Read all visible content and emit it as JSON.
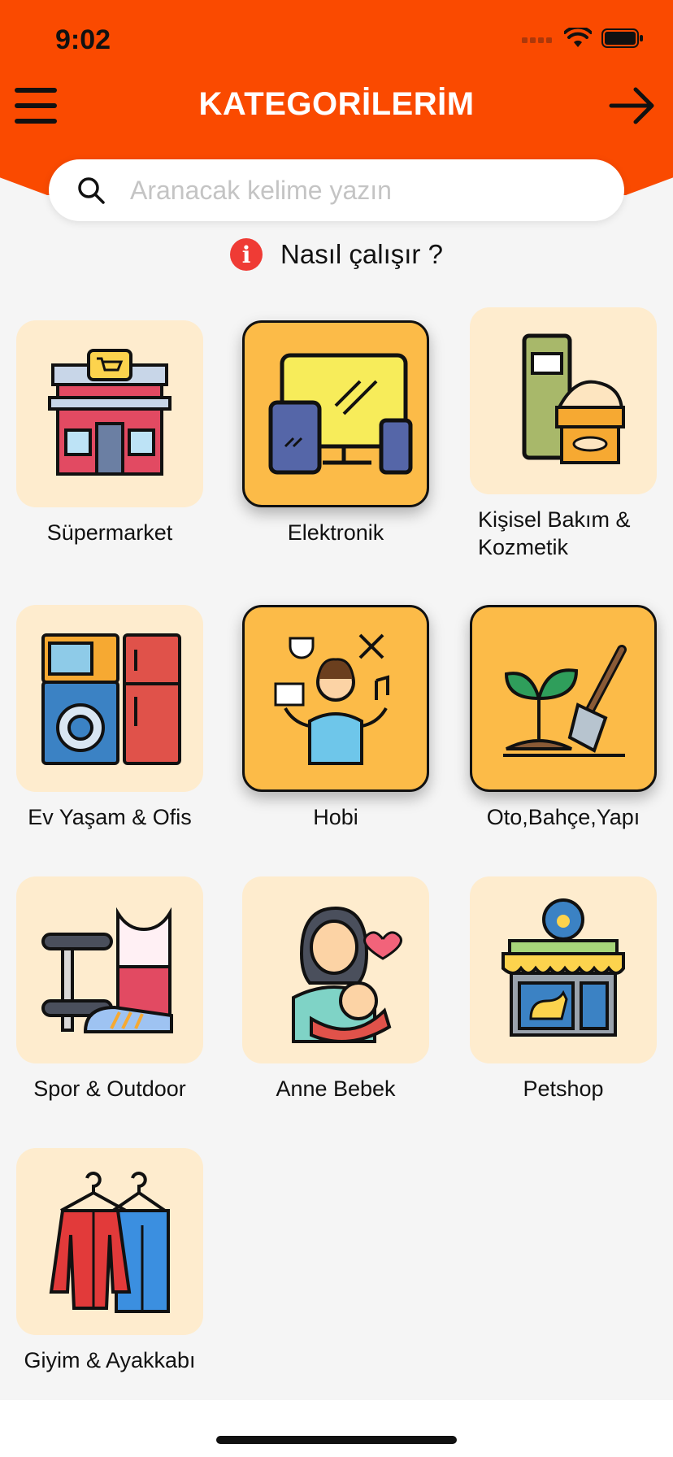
{
  "status": {
    "time": "9:02"
  },
  "header": {
    "title": "KATEGORİLERİM"
  },
  "search": {
    "placeholder": "Aranacak kelime yazın",
    "value": ""
  },
  "help": {
    "label": "Nasıl çalışır ?"
  },
  "categories": [
    {
      "label": "Süpermarket",
      "icon": "supermarket-icon",
      "selected": false
    },
    {
      "label": "Elektronik",
      "icon": "electronics-icon",
      "selected": true
    },
    {
      "label": "Kişisel Bakım & Kozmetik",
      "icon": "cosmetics-icon",
      "selected": false
    },
    {
      "label": "Ev Yaşam & Ofis",
      "icon": "home-appliances-icon",
      "selected": false
    },
    {
      "label": "Hobi",
      "icon": "hobby-icon",
      "selected": true
    },
    {
      "label": "Oto,Bahçe,Yapı",
      "icon": "garden-icon",
      "selected": true
    },
    {
      "label": "Spor & Outdoor",
      "icon": "sports-icon",
      "selected": false
    },
    {
      "label": "Anne Bebek",
      "icon": "mother-baby-icon",
      "selected": false
    },
    {
      "label": "Petshop",
      "icon": "petshop-icon",
      "selected": false
    },
    {
      "label": "Giyim & Ayakkabı",
      "icon": "clothing-icon",
      "selected": false
    }
  ],
  "colors": {
    "header": "#fa4a00",
    "tile": "#feecce",
    "tile_selected": "#fcbb48",
    "info": "#ef3b35"
  }
}
